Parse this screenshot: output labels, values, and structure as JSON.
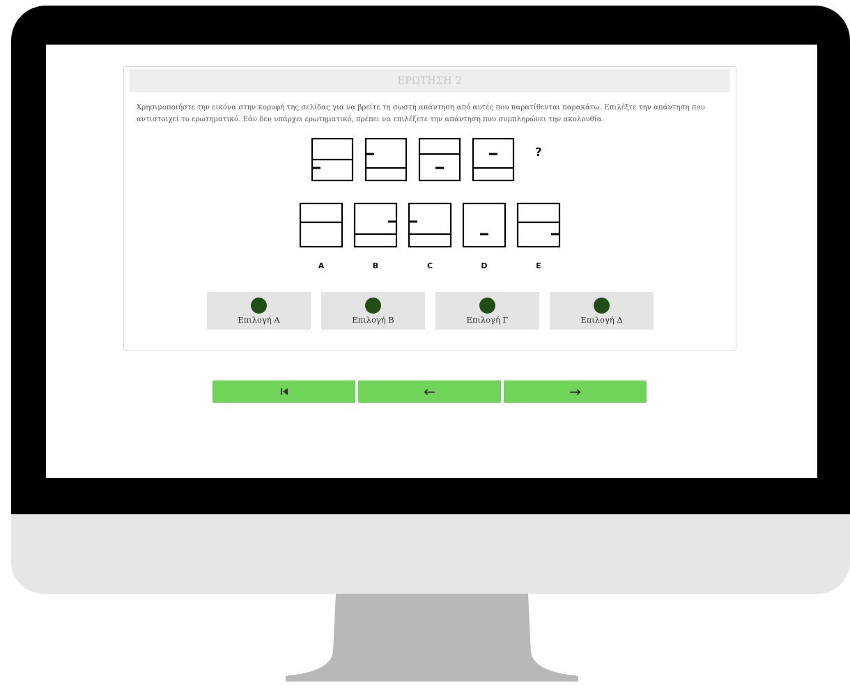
{
  "quiz": {
    "header": "ΕΡΩΤΗΣΗ 2",
    "instructions": "Χρησιμοποιήστε την εικόνα στην κορυφή της σελίδας για να βρείτε τη σωστή απάντηση από αυτές που παρατίθενται παρακάτω. Επιλέξτε την απάντηση που αντιστοιχεί το ερωτηματικό. Εάν δεν υπάρχει ερωτηματικό, πρέπει να επιλέξετε την απάντηση που συμπληρώνει την ακολουθία.",
    "question_mark": "?",
    "option_letters": [
      "A",
      "B",
      "C",
      "D",
      "E"
    ],
    "choices": [
      "Επιλογή Α",
      "Επιλογή Β",
      "Επιλογή Γ",
      "Επιλογή Δ"
    ],
    "choice_color": "#1f4d15"
  },
  "navigation": {
    "first_icon": "⏮",
    "back_icon": "←",
    "next_icon": "→",
    "icons": [
      "skip-to-first-icon",
      "arrow-left-icon",
      "arrow-right-icon"
    ],
    "button_color": "#71d45a"
  }
}
